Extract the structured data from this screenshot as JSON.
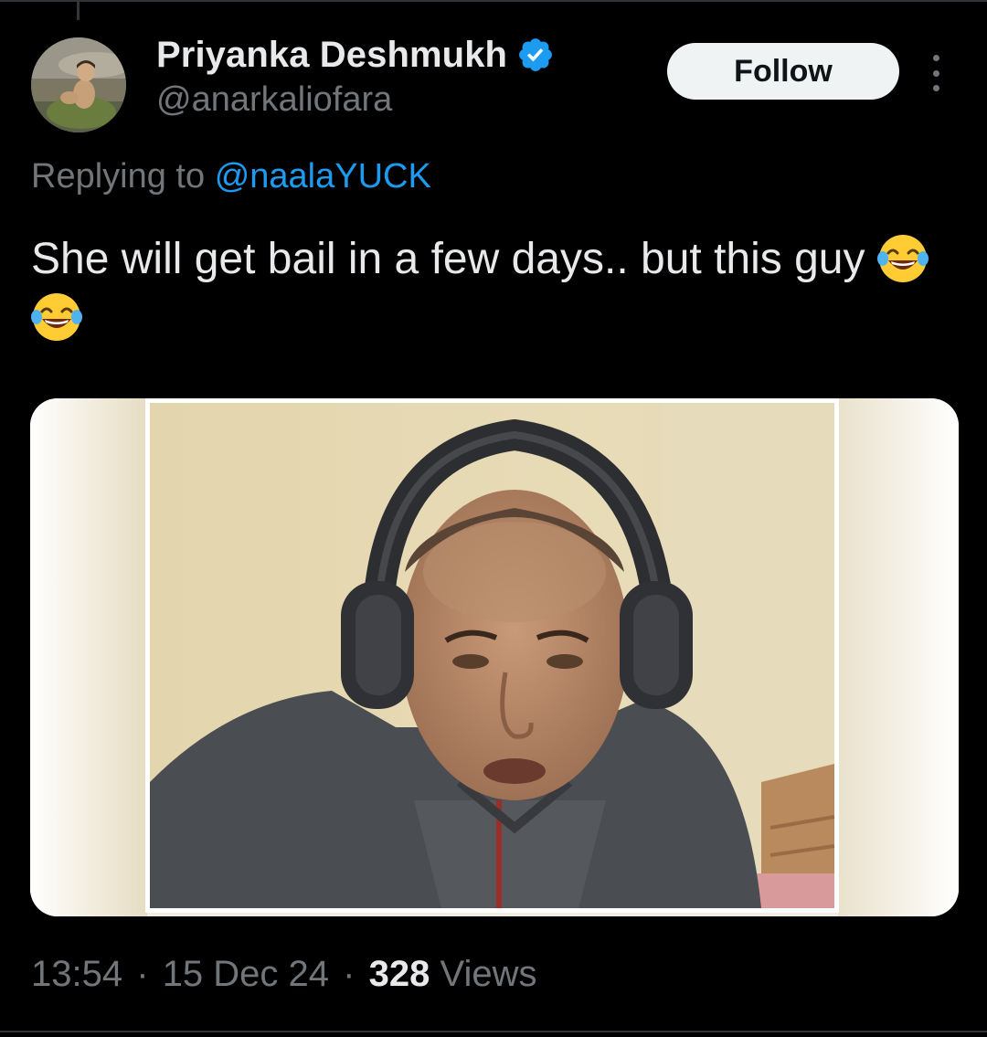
{
  "author": {
    "display_name": "Priyanka Deshmukh",
    "handle": "@anarkaliofara",
    "verified": true,
    "avatar_icon": "profile-photo"
  },
  "actions": {
    "follow_label": "Follow",
    "more_icon": "more-vertical-icon"
  },
  "reply": {
    "prefix": "Replying to",
    "mention": "@naalaYUCK"
  },
  "tweet": {
    "text": "She will get bail in a few days.. but this guy",
    "emojis": [
      "face-with-tears-of-joy",
      "face-with-tears-of-joy"
    ]
  },
  "media": {
    "type": "photo",
    "description_icon": "man-with-headphones-photo"
  },
  "meta": {
    "time": "13:54",
    "date": "15 Dec 24",
    "views_count": "328",
    "views_label": "Views",
    "separator": "·"
  },
  "colors": {
    "background": "#000000",
    "text_primary": "#e7e9ea",
    "text_secondary": "#71767b",
    "link": "#1d9bf0",
    "verified_badge": "#1d9bf0",
    "follow_bg": "#eff3f4",
    "follow_text": "#0f1419"
  }
}
